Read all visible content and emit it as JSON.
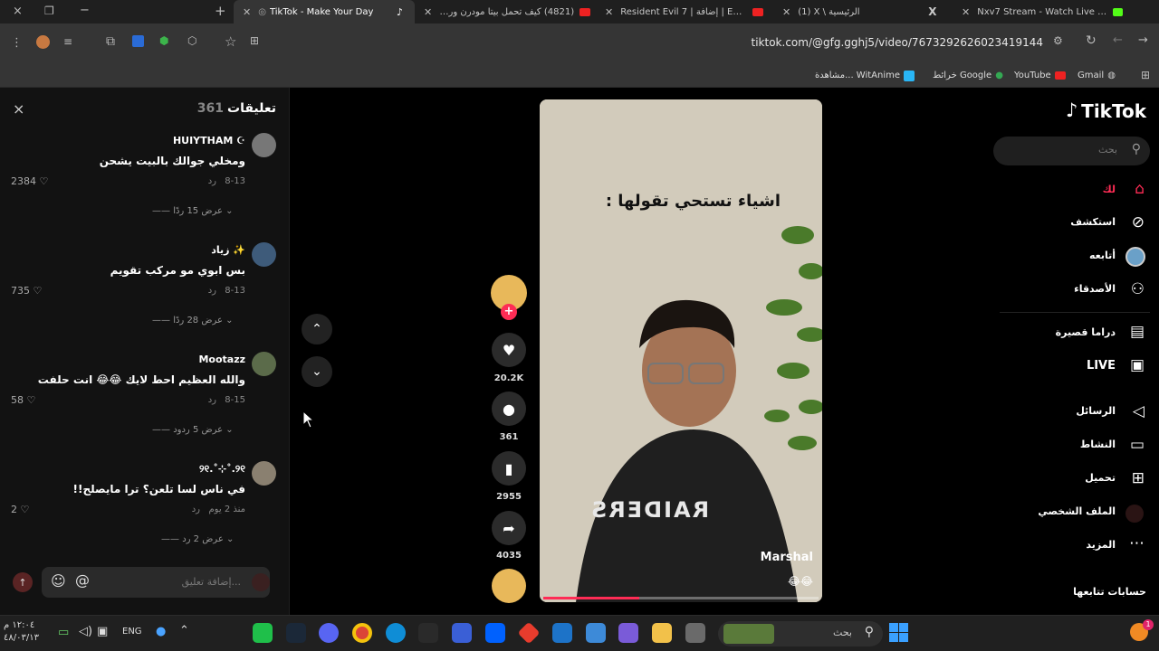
{
  "browser": {
    "tabs": [
      {
        "title": "TikTok - Make Your Day",
        "active": true
      },
      {
        "title": "(4821) كيف تحمل بيتا مودرن وراف"
      },
      {
        "title": "Resident Evil 7 | إضافة | End of Zo"
      },
      {
        "title": "(1) X \\ الرئيسية"
      },
      {
        "title": "Nxv7 Stream - Watch Live on Ki"
      }
    ],
    "url": "tiktok.com/@gfg.gghj5/video/7673292626023419144",
    "bookmarks": [
      "Gmail",
      "YouTube",
      "خرائط Google",
      "مشاهدة... WitAnime"
    ],
    "new_tab": "+",
    "close": "×",
    "minimize": "−",
    "restore": "❐"
  },
  "comments": {
    "title": "تعليقات",
    "count": "361",
    "close": "×",
    "items": [
      {
        "user": "HUIYTHAM ☪",
        "text": "ومخلي جوالك بالبيت يشحن",
        "date": "8-13",
        "reply": "رد",
        "likes": "2384",
        "view_replies": "عرض 15 ردًا"
      },
      {
        "user": "زياد ✨",
        "text": "بس ابوي مو مركب تقويم",
        "date": "8-13",
        "reply": "رد",
        "likes": "735",
        "view_replies": "عرض 28 ردًا"
      },
      {
        "user": "Mootazz",
        "text": "والله العظيم احط لايك 😂😂 انت حلفت",
        "date": "8-15",
        "reply": "رد",
        "likes": "58",
        "view_replies": "عرض 5 ردود"
      },
      {
        "user": "୨୧.˚⊹˚.୨୧",
        "text": "في ناس لسا تلعن؟ ترا مايصلح!!",
        "date": "منذ 2 يوم",
        "reply": "رد",
        "likes": "2",
        "view_replies": "عرض 2 رد"
      }
    ],
    "input_placeholder": "إضافة تعليق...",
    "mention": "@",
    "emoji": "☺"
  },
  "video": {
    "caption": "اشياء تستحي تقولها :",
    "author": "Marshal",
    "progress": 0.35,
    "emoji": "😂😂",
    "shirt_text": "RAIDERS"
  },
  "actions": {
    "likes": "20.2K",
    "comments": "361",
    "saves": "2955",
    "shares": "4035"
  },
  "nav": {
    "logo": "TikTok",
    "search_placeholder": "بحث",
    "items": [
      {
        "label": "لك",
        "icon": "home-icon",
        "active": true
      },
      {
        "label": "استكشف",
        "icon": "compass-icon"
      },
      {
        "label": "أتابعه",
        "icon": "avatar-icon"
      },
      {
        "label": "الأصدقاء",
        "icon": "friends-icon"
      },
      {
        "label": "دراما قصيرة",
        "icon": "film-icon"
      },
      {
        "label": "LIVE",
        "icon": "live-icon"
      },
      {
        "label": "الرسائل",
        "icon": "send-icon"
      },
      {
        "label": "النشاط",
        "icon": "activity-icon"
      },
      {
        "label": "تحميل",
        "icon": "upload-icon"
      },
      {
        "label": "الملف الشخصي",
        "icon": "profile-icon"
      },
      {
        "label": "المزيد",
        "icon": "more-icon"
      }
    ],
    "following_title": "حسابات تتابعها"
  },
  "taskbar": {
    "search_placeholder": "بحث",
    "lang": "ENG",
    "time": "١٢:٠٤ م",
    "date": "٤٨/٠٣/١٣",
    "notification_count": "1"
  }
}
